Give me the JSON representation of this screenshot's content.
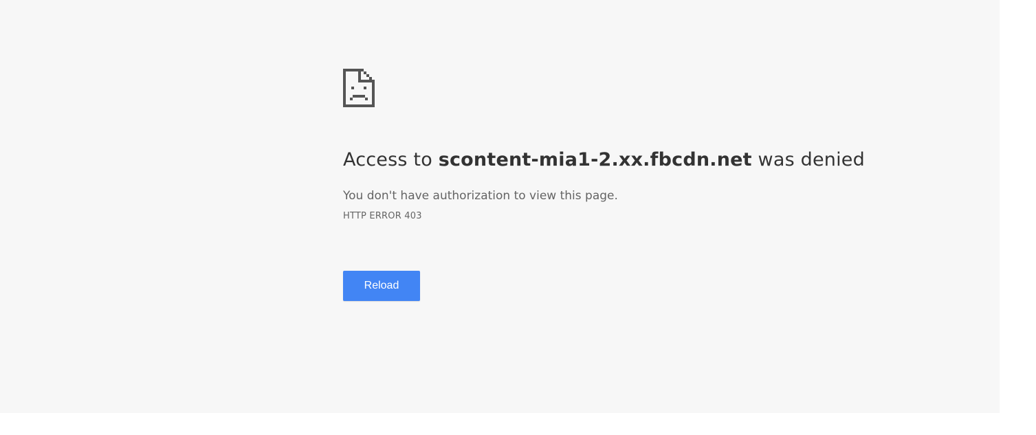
{
  "error_page": {
    "icon": "sad-document-icon",
    "headline_prefix": "Access to ",
    "host": "scontent-mia1-2.xx.fbcdn.net",
    "headline_suffix": " was denied",
    "summary": "You don't have authorization to view this page.",
    "error_code": "HTTP ERROR 403",
    "reload_label": "Reload"
  },
  "colors": {
    "background": "#f7f7f7",
    "headline_text": "#333333",
    "secondary_text": "#646464",
    "button_background": "#4285f4",
    "button_text": "#ffffff",
    "icon": "#555555"
  }
}
